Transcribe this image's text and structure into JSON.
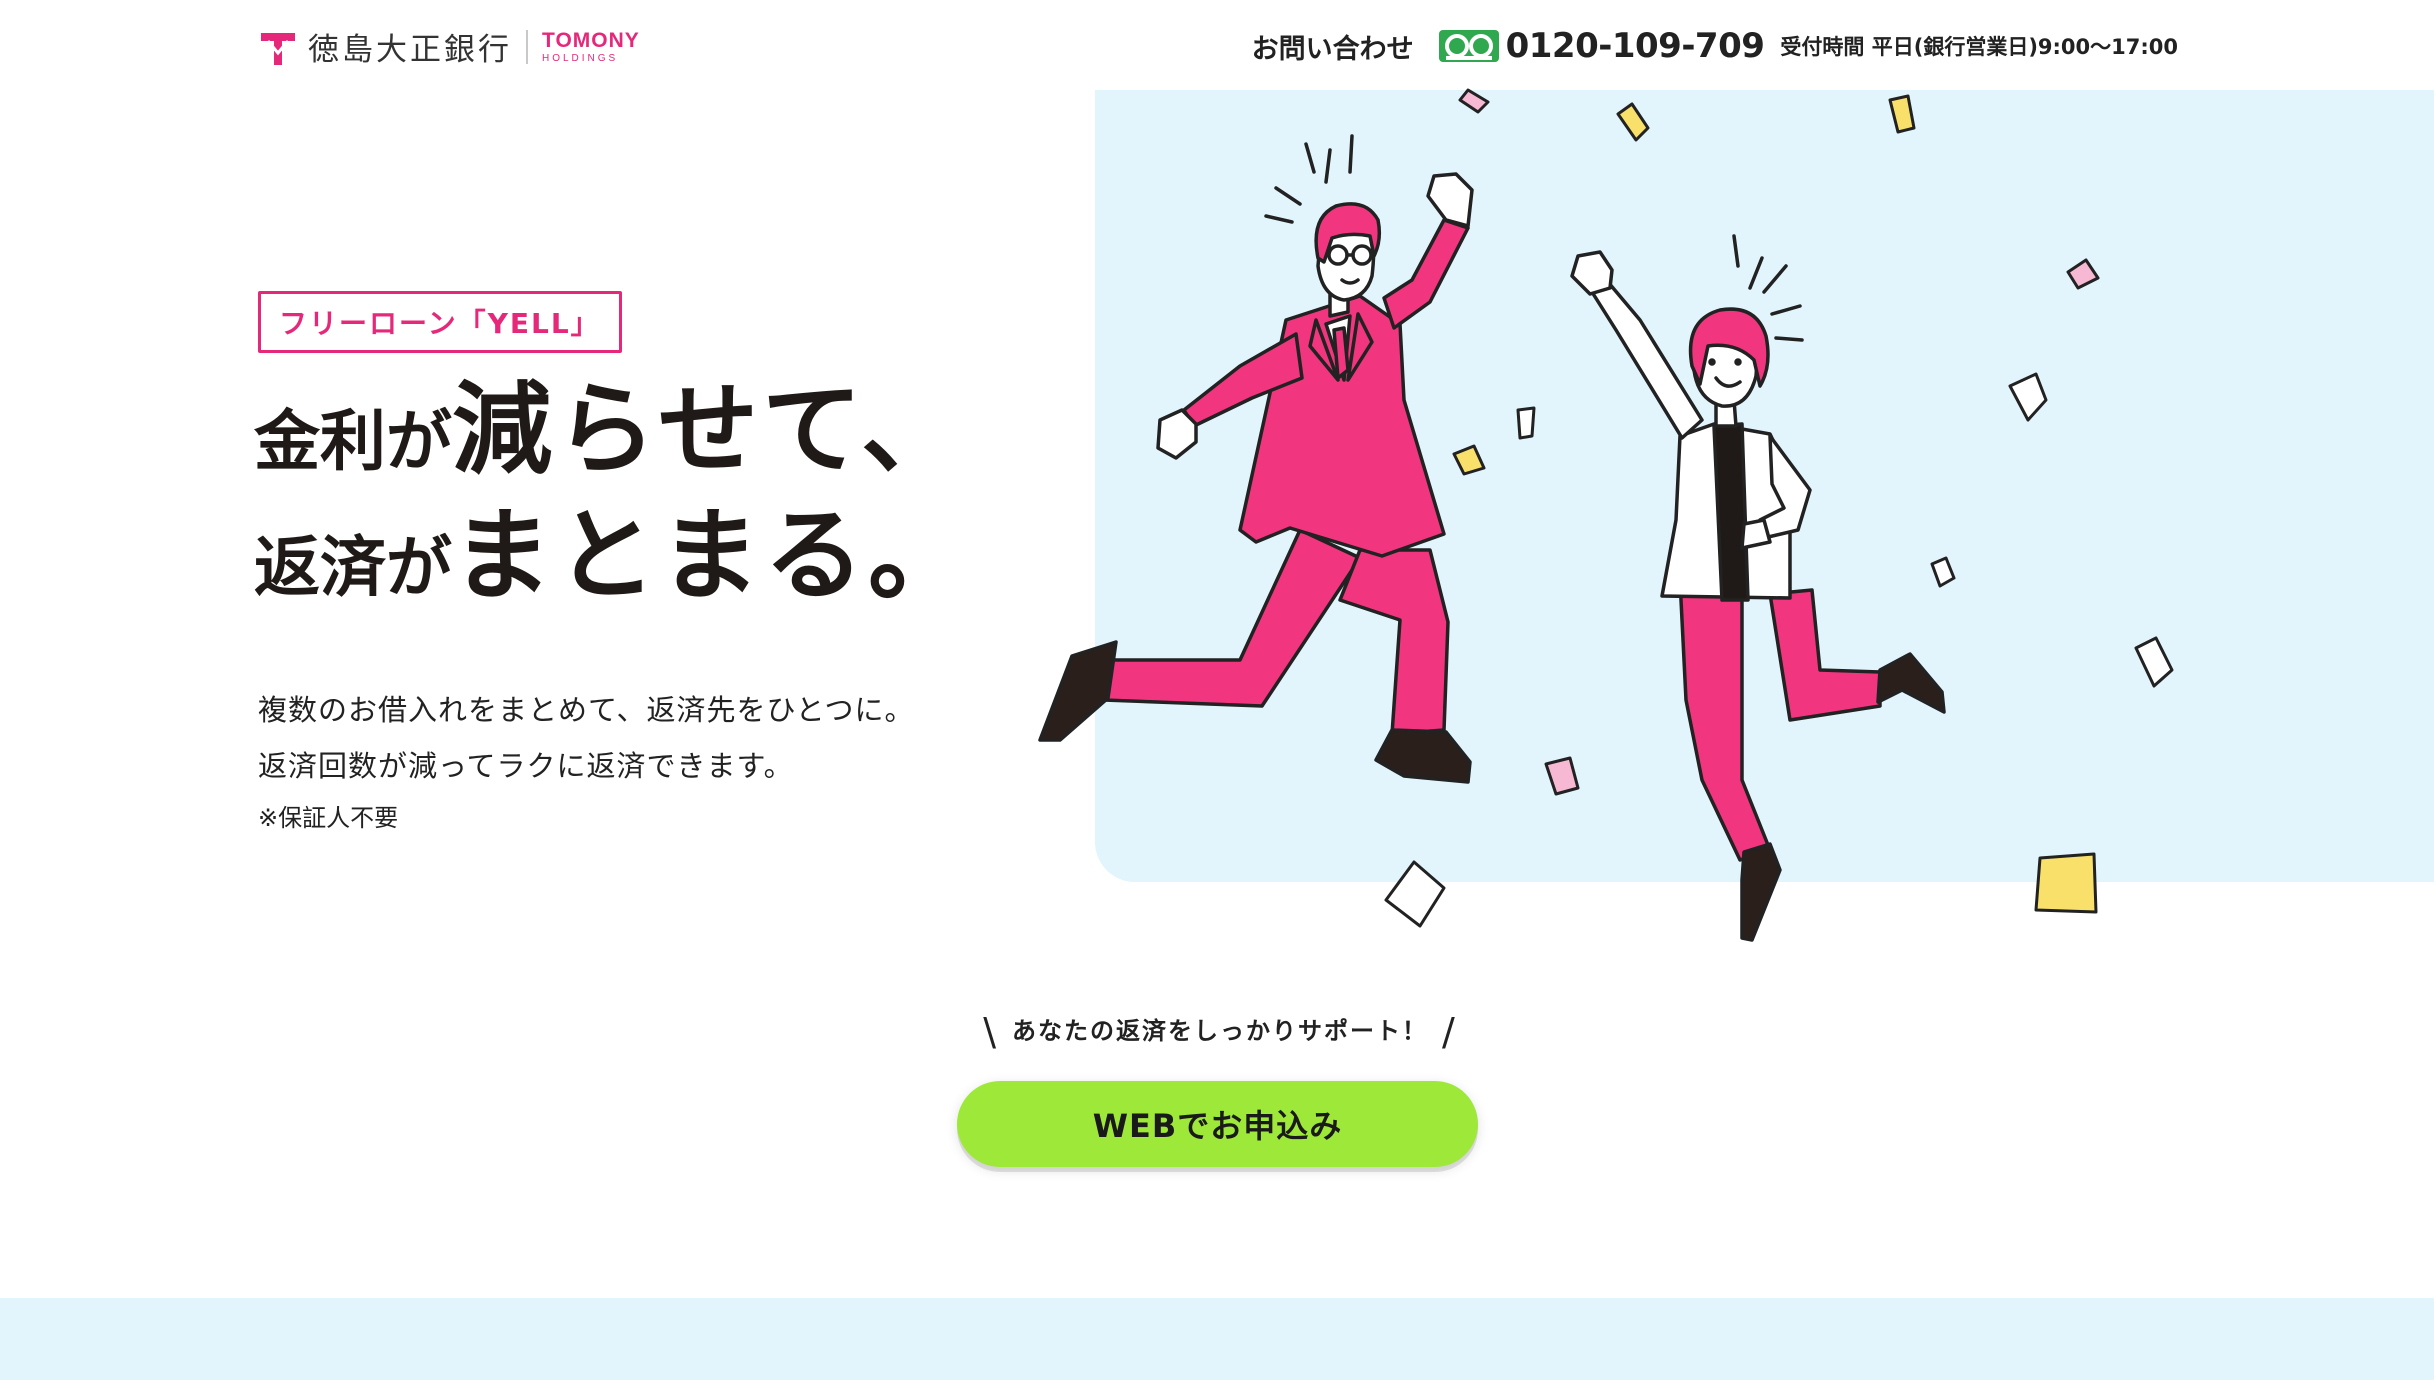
{
  "header": {
    "bank_name": "徳島大正銀行",
    "group_name": "TOMONY",
    "group_sub": "HOLDINGS",
    "contact_label": "お問い合わせ",
    "phone": "0120-109-709",
    "hours": "受付時間 平日(銀行営業日)9:00〜17:00"
  },
  "hero": {
    "badge": "フリーローン「YELL」",
    "headline": {
      "l1_a": "金利が",
      "l1_b": "減らせて、",
      "l2_a": "返済が",
      "l2_b": "まとまる。"
    },
    "desc_1": "複数のお借入れをまとめて、返済先をひとつに。",
    "desc_2": "返済回数が減ってラクに返済できます。",
    "note": "※保証人不要"
  },
  "cta": {
    "support_text": "あなたの返済をしっかりサポート！",
    "button_label": "WEBでお申込み"
  },
  "colors": {
    "brand_pink": "#e6287a",
    "cta_green": "#9ee83a",
    "hero_bg": "#e2f4fc",
    "confetti_yellow": "#f8e06a",
    "confetti_pink": "#f7b8d3"
  },
  "icons": [
    "tokushima-taisho-logo-mark",
    "free-dial-icon",
    "jumping-business-people-illustration"
  ]
}
